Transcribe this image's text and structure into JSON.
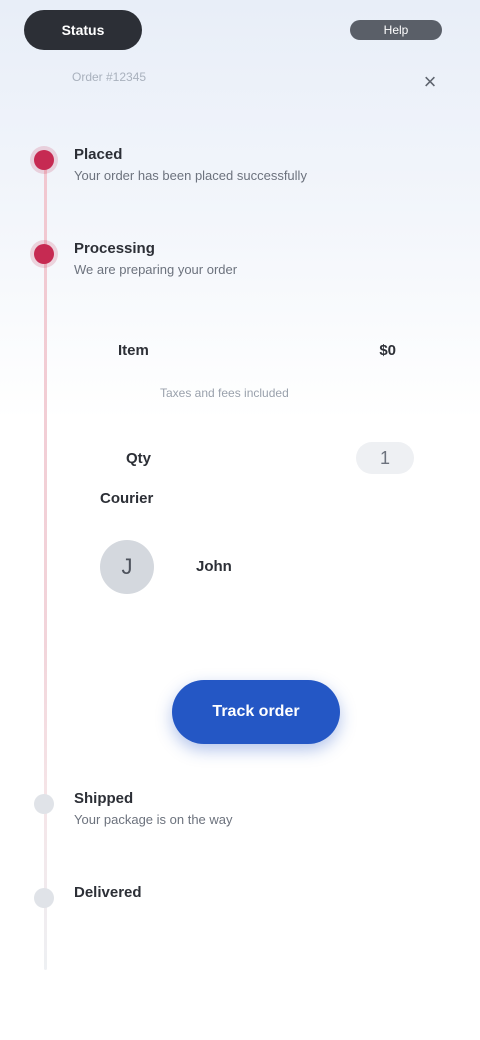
{
  "header": {
    "left_pill": "Status",
    "right_label": "Help",
    "subtitle": "Order #12345",
    "close_glyph": "×"
  },
  "timeline": [
    {
      "title": "Placed",
      "subtitle": "Your order has been placed successfully",
      "state": "active"
    },
    {
      "title": "Processing",
      "subtitle": "We are preparing your order",
      "state": "active"
    },
    {
      "title": "Shipped",
      "subtitle": "Your package is on the way",
      "state": "pending"
    },
    {
      "title": "Delivered",
      "subtitle": "",
      "state": "pending"
    }
  ],
  "details": {
    "row1_label": "Item",
    "row1_value": "$0",
    "note": "Taxes and fees included",
    "row2_label": "Qty",
    "row2_chip": "1",
    "section_title": "Courier",
    "avatar_initial": "J",
    "courier_name": "John",
    "avatar_caption": "",
    "courier_caption": ""
  },
  "actions": {
    "primary": "Track order"
  },
  "colors": {
    "accent": "#c62a52",
    "primary": "#2457c5"
  }
}
